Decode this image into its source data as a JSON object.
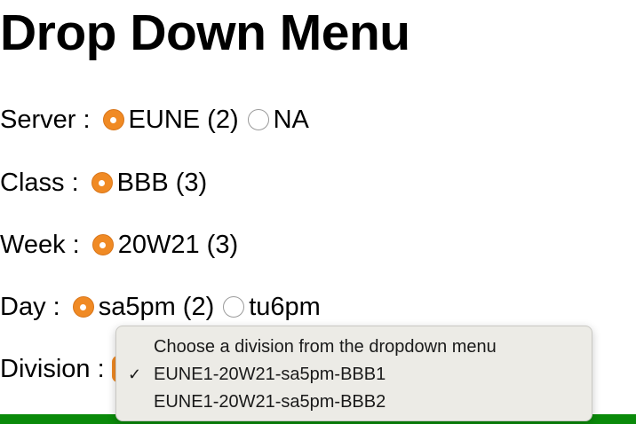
{
  "page": {
    "title": "Drop Down Menu"
  },
  "form": {
    "server": {
      "label": "Server :",
      "options": [
        {
          "label": "EUNE (2)",
          "checked": true
        },
        {
          "label": "NA",
          "checked": false
        }
      ]
    },
    "class": {
      "label": "Class :",
      "options": [
        {
          "label": "BBB (3)",
          "checked": true
        }
      ]
    },
    "week": {
      "label": "Week :",
      "options": [
        {
          "label": "20W21 (3)",
          "checked": true
        }
      ]
    },
    "day": {
      "label": "Day :",
      "options": [
        {
          "label": "sa5pm (2)",
          "checked": true
        },
        {
          "label": "tu6pm",
          "checked": false
        }
      ]
    },
    "division": {
      "label": "Division :"
    }
  },
  "dropdown": {
    "options": [
      {
        "label": "Choose a division from the dropdown menu",
        "selected": false
      },
      {
        "label": "EUNE1-20W21-sa5pm-BBB1",
        "selected": true
      },
      {
        "label": "EUNE1-20W21-sa5pm-BBB2",
        "selected": false
      }
    ],
    "check_glyph": "✓"
  },
  "colors": {
    "radio_checked": "#f08a24",
    "menu_background": "#ecebe6",
    "footer_bar": "#0a8a0a"
  }
}
